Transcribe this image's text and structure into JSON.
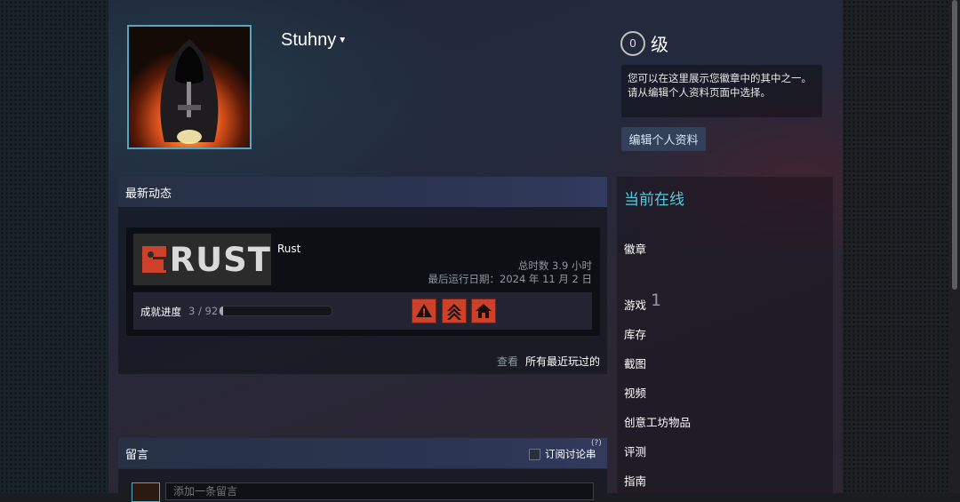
{
  "profile": {
    "persona_name": "Stuhny",
    "level_value": "0",
    "level_label": "级",
    "badge_hint": "您可以在这里展示您徽章中的其中之一。请从编辑个人资料页面中选择。",
    "edit_button": "编辑个人资料"
  },
  "activity": {
    "header": "最新动态",
    "game": {
      "logo_text": "RUST",
      "name": "Rust",
      "total_time": "总时数 3.9 小时",
      "last_played": "最后运行日期：2024 年 11 月 2 日",
      "achievement_label": "成就进度",
      "achievement_count": "3 / 92",
      "achievement_progress": 0.033,
      "achievement_icons": [
        "warning-icon",
        "chevron-up-icon",
        "home-icon"
      ]
    },
    "view_prefix": "查看",
    "view_link": "所有最近玩过的"
  },
  "comments": {
    "header": "留言",
    "subscribe_label": "订阅讨论串",
    "help_mark": "(?)",
    "input_placeholder": "添加一条留言"
  },
  "sidebar": {
    "online_status": "当前在线",
    "badges": "徽章",
    "games": "游戏",
    "games_count": "1",
    "inventory": "库存",
    "screenshots": "截图",
    "videos": "视频",
    "workshop": "创意工坊物品",
    "reviews": "评测",
    "guides": "指南"
  },
  "colors": {
    "accent_blue": "#57cbde",
    "rust_red": "#cd412b",
    "panel_header": "#2c3552"
  }
}
